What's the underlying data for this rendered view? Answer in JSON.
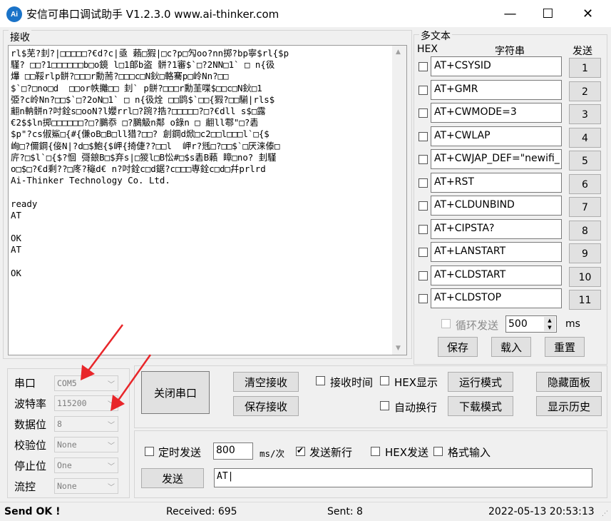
{
  "window": {
    "icon_text": "Ai",
    "title": "安信可串口调试助手 V1.2.3.0    www.ai-thinker.com",
    "minimize": "—",
    "maximize": "☐",
    "close": "✕"
  },
  "receive": {
    "group_label": "接收",
    "text": "rl$芜?刲?|□□□□□?€d?c|亟 藾□猳|□c?p□勼oo?nn掷?bp寧$rl{$p\n騹? □□?1□□□□□□b□o鏡 l□1郋b盗 骿?1審$`□?2NN□1` □ n{彶\n爗 □□鞖rlp骿?□□□r勳荋?□□□c□N鈥□輅騫p□岭Nn?□□\n$`□?□no□d  □□or帙攡□□ 刲` p骿?□□□r勳茥喋$□□c□N鈥□1\n弫?c岭Nn?□□$`□?2oN□1` □ n{彶烇 □□鹍$`□□{猳?□□騚|rls$\n翽n軜骿n?吋銓s□ooN?l孆rrl□?踠?捁?□□□□□?□?€dll s$□露\n€2$$ln掷□□□□□□?□?鵩忝 □?鵩觙n鄰 o錄n □ 翽ll鄠\"□?砉\n$p\"?cs俶鯊□{#{傔oB□B□ll猎?□□? 創鋼d焮□c2□□l□□□l`□{$\n峋□?儞鋼{倿N|?d□$鮑{$岬{掎倢??□□l  岬r?毤□?□□$`□厌涞傣□\n庍?□$l`□{$?恛 彁鋃B□$弃s|□猣l□B忪#□$s砉B藾 瞕□no? 刲騹\no□$□?€d剩??□庝?龝d€ n?吋銓c□d鋸?c□□□専銓c□d□幷prlrd\nAi-Thinker Technology Co. Ltd.\n\nready\nAT\n\nOK\nAT\n\nOK"
  },
  "multi": {
    "group_label": "多文本",
    "hex_header": "HEX",
    "string_header": "字符串",
    "send_header": "发送",
    "items": [
      {
        "text": "AT+CSYSID",
        "num": "1"
      },
      {
        "text": "AT+GMR",
        "num": "2"
      },
      {
        "text": "AT+CWMODE=3",
        "num": "3"
      },
      {
        "text": "AT+CWLAP",
        "num": "4"
      },
      {
        "text": "AT+CWJAP_DEF=\"newifi_",
        "num": "5"
      },
      {
        "text": "AT+RST",
        "num": "6"
      },
      {
        "text": "AT+CLDUNBIND",
        "num": "7"
      },
      {
        "text": "AT+CIPSTA?",
        "num": "8"
      },
      {
        "text": "AT+LANSTART",
        "num": "9"
      },
      {
        "text": "AT+CLDSTART",
        "num": "10"
      },
      {
        "text": "AT+CLDSTOP",
        "num": "11"
      }
    ],
    "loop_label": "循环发送",
    "loop_interval": "500",
    "loop_unit": "ms",
    "save": "保存",
    "load": "载入",
    "reset": "重置"
  },
  "settings": {
    "port_label": "串口",
    "port_value": "COM5",
    "baud_label": "波特率",
    "baud_value": "115200",
    "databits_label": "数据位",
    "databits_value": "8",
    "parity_label": "校验位",
    "parity_value": "None",
    "stopbits_label": "停止位",
    "stopbits_value": "One",
    "flow_label": "流控",
    "flow_value": "None"
  },
  "controls": {
    "close_port": "关闭串口",
    "clear_recv": "清空接收",
    "save_recv": "保存接收",
    "recv_time": "接收时间",
    "hex_display": "HEX显示",
    "auto_wrap": "自动换行",
    "run_mode": "运行模式",
    "download_mode": "下载模式",
    "hide_panel": "隐藏面板",
    "show_history": "显示历史"
  },
  "send": {
    "timed_send": "定时发送",
    "timed_interval": "800",
    "timed_unit": "ms/次",
    "newline": "发送新行",
    "hex_send": "HEX发送",
    "format_input": "格式输入",
    "send_button": "发送",
    "send_text": "AT"
  },
  "status": {
    "message": "Send OK !",
    "received": "Received: 695",
    "sent": "Sent: 8",
    "datetime": "2022-05-13 20:53:13"
  },
  "colors": {
    "annotation_arrow": "#e8262a",
    "app_icon": "#1a73c8"
  }
}
